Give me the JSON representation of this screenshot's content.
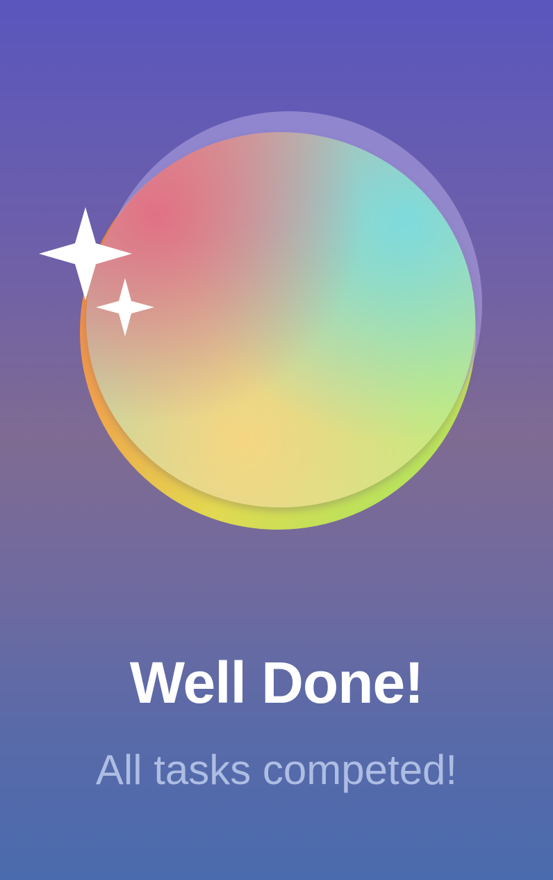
{
  "completion": {
    "title": "Well Done!",
    "subtitle": "All tasks competed!"
  },
  "badge": {
    "icon": "sparkles-icon",
    "colors": {
      "coral": "#e26e84",
      "teal": "#7adce0",
      "yellow": "#f8d680",
      "lime": "#c4ec78",
      "orange": "#e66a4a"
    }
  },
  "background": {
    "top": "#5956bd",
    "middle": "#7f6b92",
    "bottom": "#4a6bad"
  }
}
